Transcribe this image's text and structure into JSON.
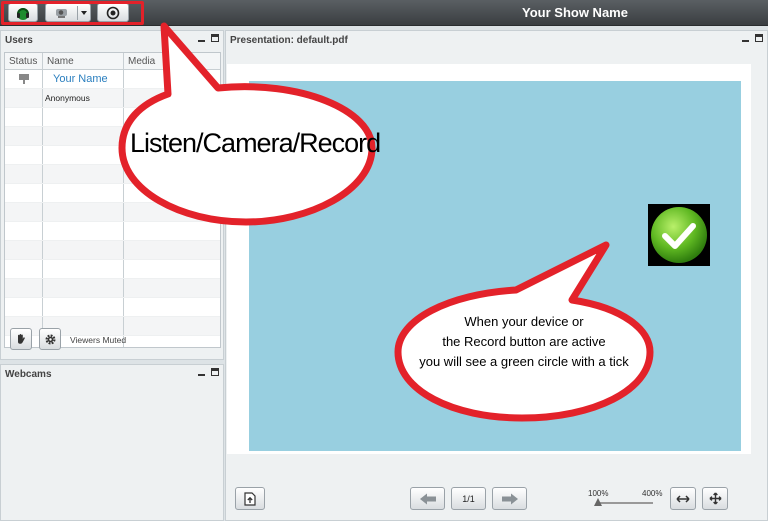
{
  "header": {
    "show_name": "Your Show Name",
    "buttons": [
      {
        "icon": "headset-icon",
        "label": "Listen"
      },
      {
        "icon": "webcam-icon",
        "label": "Camera"
      },
      {
        "icon": "record-icon",
        "label": "Record"
      }
    ],
    "highlight_color": "#e3222a"
  },
  "users_panel": {
    "title": "Users",
    "columns": [
      "Status",
      "Name",
      "Media"
    ],
    "rows": [
      {
        "status_icon": "presenter-icon",
        "name": "Your Name",
        "media_icon": "speaker-icon"
      },
      {
        "status_icon": "",
        "name": "Anonymous",
        "media_icon": "speaker-icon"
      }
    ],
    "muted_label": "Viewers Muted"
  },
  "webcams_panel": {
    "title": "Webcams"
  },
  "presentation": {
    "title": "Presentation: default.pdf",
    "page_indicator": "1/1",
    "zoom_min": "100%",
    "zoom_max": "400%",
    "zoom_level": 0.0,
    "slide_color": "#98cfe0"
  },
  "annotations": {
    "callout_top": "Listen/Camera/Record",
    "callout_bottom": [
      "When your device or",
      "the Record button are active",
      "you will see a green circle with a tick"
    ]
  }
}
